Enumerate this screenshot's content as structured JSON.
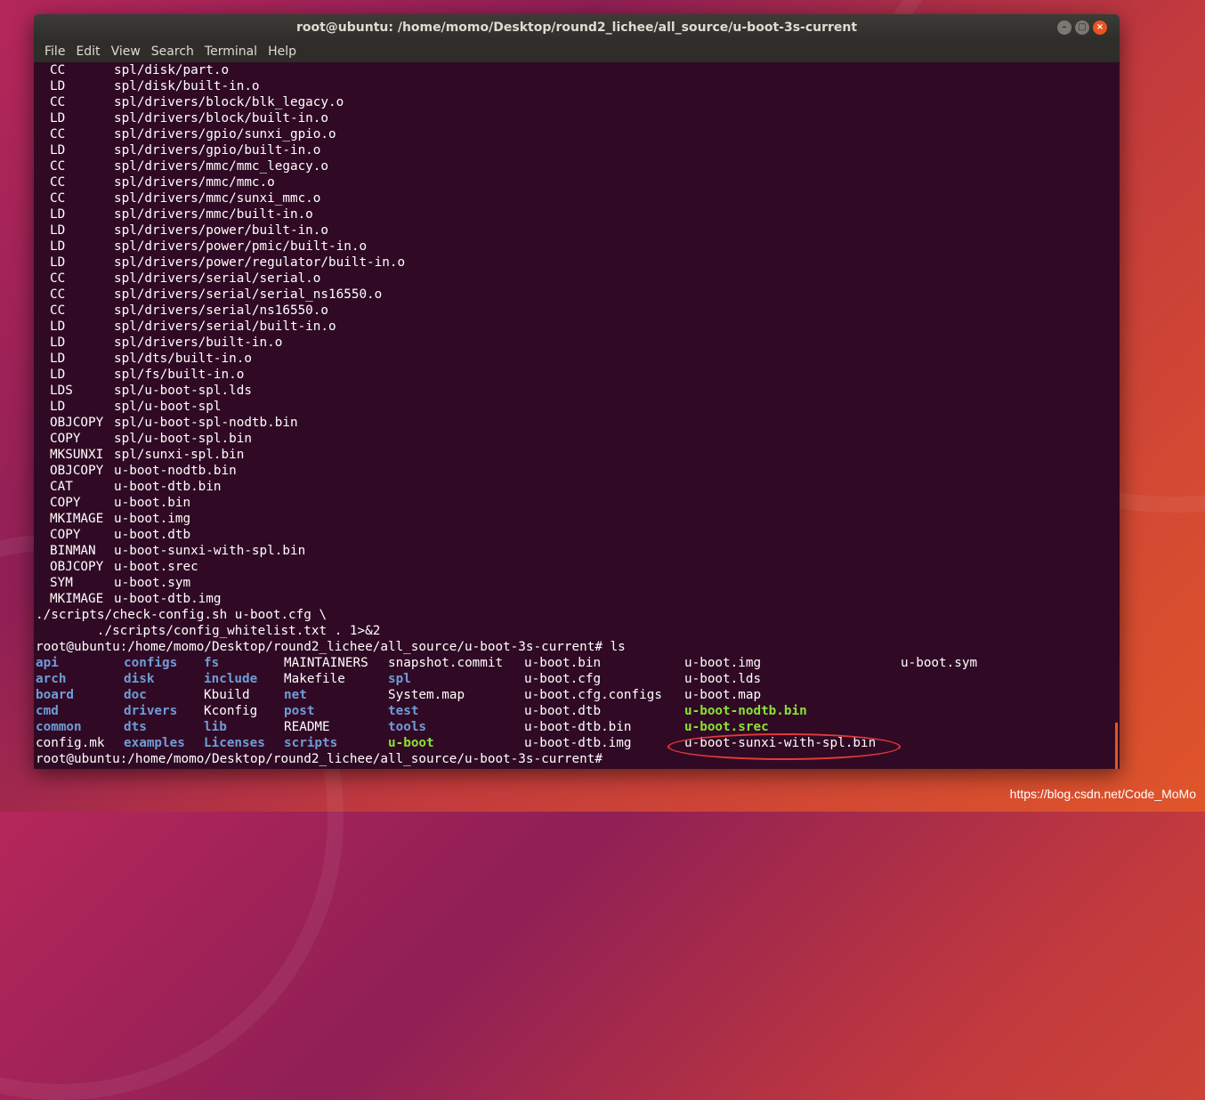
{
  "window": {
    "title": "root@ubuntu: /home/momo/Desktop/round2_lichee/all_source/u-boot-3s-current",
    "buttons": [
      "–",
      "□",
      "×"
    ]
  },
  "menubar": [
    "File",
    "Edit",
    "View",
    "Search",
    "Terminal",
    "Help"
  ],
  "build_lines": [
    [
      "CC",
      "spl/disk/part.o"
    ],
    [
      "LD",
      "spl/disk/built-in.o"
    ],
    [
      "CC",
      "spl/drivers/block/blk_legacy.o"
    ],
    [
      "LD",
      "spl/drivers/block/built-in.o"
    ],
    [
      "CC",
      "spl/drivers/gpio/sunxi_gpio.o"
    ],
    [
      "LD",
      "spl/drivers/gpio/built-in.o"
    ],
    [
      "CC",
      "spl/drivers/mmc/mmc_legacy.o"
    ],
    [
      "CC",
      "spl/drivers/mmc/mmc.o"
    ],
    [
      "CC",
      "spl/drivers/mmc/sunxi_mmc.o"
    ],
    [
      "LD",
      "spl/drivers/mmc/built-in.o"
    ],
    [
      "LD",
      "spl/drivers/power/built-in.o"
    ],
    [
      "LD",
      "spl/drivers/power/pmic/built-in.o"
    ],
    [
      "LD",
      "spl/drivers/power/regulator/built-in.o"
    ],
    [
      "CC",
      "spl/drivers/serial/serial.o"
    ],
    [
      "CC",
      "spl/drivers/serial/serial_ns16550.o"
    ],
    [
      "CC",
      "spl/drivers/serial/ns16550.o"
    ],
    [
      "LD",
      "spl/drivers/serial/built-in.o"
    ],
    [
      "LD",
      "spl/drivers/built-in.o"
    ],
    [
      "LD",
      "spl/dts/built-in.o"
    ],
    [
      "LD",
      "spl/fs/built-in.o"
    ],
    [
      "LDS",
      "spl/u-boot-spl.lds"
    ],
    [
      "LD",
      "spl/u-boot-spl"
    ],
    [
      "OBJCOPY",
      "spl/u-boot-spl-nodtb.bin"
    ],
    [
      "COPY",
      "spl/u-boot-spl.bin"
    ],
    [
      "MKSUNXI",
      "spl/sunxi-spl.bin"
    ],
    [
      "OBJCOPY",
      "u-boot-nodtb.bin"
    ],
    [
      "CAT",
      "u-boot-dtb.bin"
    ],
    [
      "COPY",
      "u-boot.bin"
    ],
    [
      "MKIMAGE",
      "u-boot.img"
    ],
    [
      "COPY",
      "u-boot.dtb"
    ],
    [
      "BINMAN",
      "u-boot-sunxi-with-spl.bin"
    ],
    [
      "OBJCOPY",
      "u-boot.srec"
    ],
    [
      "SYM",
      "u-boot.sym"
    ],
    [
      "MKIMAGE",
      "u-boot-dtb.img"
    ]
  ],
  "script_line_1": "./scripts/check-config.sh u-boot.cfg \\",
  "script_line_2": "        ./scripts/config_whitelist.txt . 1>&2",
  "prompt_ls": "root@ubuntu:/home/momo/Desktop/round2_lichee/all_source/u-boot-3s-current# ls",
  "ls_rows": [
    [
      [
        "api",
        "blue"
      ],
      [
        "configs",
        "blue"
      ],
      [
        "fs",
        "blue"
      ],
      [
        "MAINTAINERS",
        "white"
      ],
      [
        "snapshot.commit",
        "white"
      ],
      [
        "u-boot.bin",
        "white"
      ],
      [
        "u-boot.img",
        "white"
      ],
      [
        "u-boot.sym",
        "white"
      ]
    ],
    [
      [
        "arch",
        "blue"
      ],
      [
        "disk",
        "blue"
      ],
      [
        "include",
        "blue"
      ],
      [
        "Makefile",
        "white"
      ],
      [
        "spl",
        "blue"
      ],
      [
        "u-boot.cfg",
        "white"
      ],
      [
        "u-boot.lds",
        "white"
      ],
      [
        "",
        ""
      ]
    ],
    [
      [
        "board",
        "blue"
      ],
      [
        "doc",
        "blue"
      ],
      [
        "Kbuild",
        "white"
      ],
      [
        "net",
        "blue"
      ],
      [
        "System.map",
        "white"
      ],
      [
        "u-boot.cfg.configs",
        "white"
      ],
      [
        "u-boot.map",
        "white"
      ],
      [
        "",
        ""
      ]
    ],
    [
      [
        "cmd",
        "blue"
      ],
      [
        "drivers",
        "blue"
      ],
      [
        "Kconfig",
        "white"
      ],
      [
        "post",
        "blue"
      ],
      [
        "test",
        "blue"
      ],
      [
        "u-boot.dtb",
        "white"
      ],
      [
        "u-boot-nodtb.bin",
        "green"
      ],
      [
        "",
        ""
      ]
    ],
    [
      [
        "common",
        "blue"
      ],
      [
        "dts",
        "blue"
      ],
      [
        "lib",
        "blue"
      ],
      [
        "README",
        "white"
      ],
      [
        "tools",
        "blue"
      ],
      [
        "u-boot-dtb.bin",
        "white"
      ],
      [
        "u-boot.srec",
        "green"
      ],
      [
        "",
        ""
      ]
    ],
    [
      [
        "config.mk",
        "white"
      ],
      [
        "examples",
        "blue"
      ],
      [
        "Licenses",
        "blue"
      ],
      [
        "scripts",
        "blue"
      ],
      [
        "u-boot",
        "green"
      ],
      [
        "u-boot-dtb.img",
        "white"
      ],
      [
        "u-boot-sunxi-with-spl.bin",
        "white"
      ],
      [
        "",
        ""
      ]
    ]
  ],
  "prompt_final": "root@ubuntu:/home/momo/Desktop/round2_lichee/all_source/u-boot-3s-current# ",
  "watermark": "https://blog.csdn.net/Code_MoMo",
  "colors": {
    "terminal_bg": "#300a24",
    "dir": "#6f9cd8",
    "exec": "#8ae234",
    "accent": "#e95420"
  }
}
